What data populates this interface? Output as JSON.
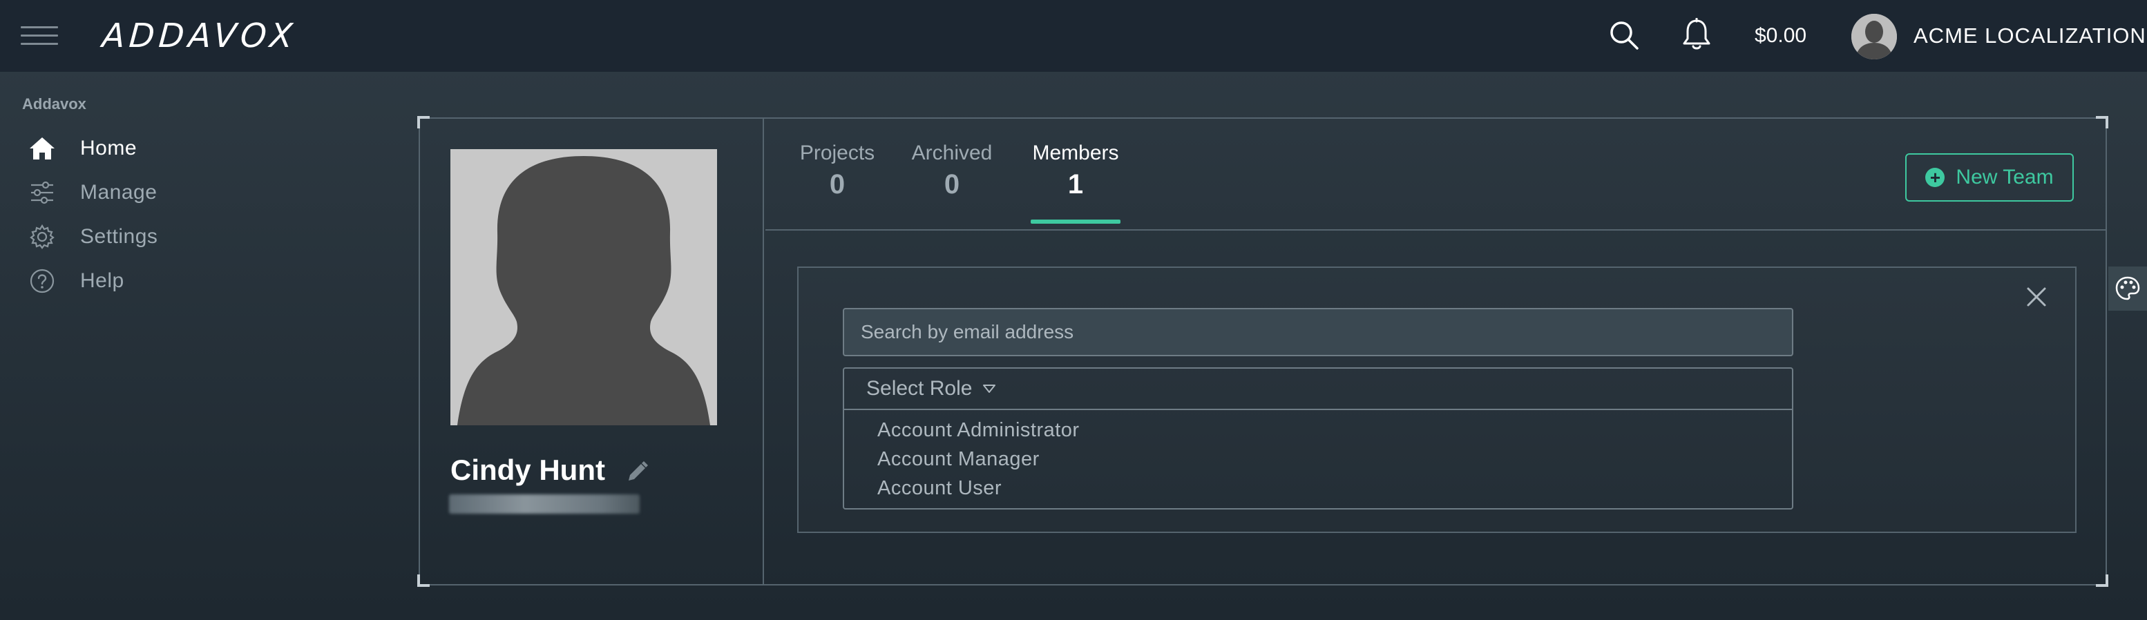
{
  "header": {
    "logo_text": "ADDAVOX",
    "balance": "$0.00",
    "account_name": "ACME LOCALIZATION",
    "icons": [
      "menu-icon",
      "search-icon",
      "bell-icon",
      "avatar"
    ]
  },
  "sidebar": {
    "heading": "Addavox",
    "items": [
      {
        "label": "Home",
        "icon": "home-icon",
        "active": true
      },
      {
        "label": "Manage",
        "icon": "sliders-icon",
        "active": false
      },
      {
        "label": "Settings",
        "icon": "gear-icon",
        "active": false
      },
      {
        "label": "Help",
        "icon": "help-icon",
        "active": false
      }
    ]
  },
  "profile": {
    "name": "Cindy Hunt"
  },
  "tabs": [
    {
      "label": "Projects",
      "count": "0",
      "active": false
    },
    {
      "label": "Archived",
      "count": "0",
      "active": false
    },
    {
      "label": "Members",
      "count": "1",
      "active": true
    }
  ],
  "actions": {
    "new_team_label": "New Team"
  },
  "add_member": {
    "search_placeholder": "Search by email address",
    "role_placeholder": "Select Role",
    "role_options": [
      "Account Administrator",
      "Account Manager",
      "Account User"
    ]
  },
  "colors": {
    "accent": "#3ec9a0",
    "topbar": "#1c2631",
    "text_muted": "#9fabb3"
  }
}
